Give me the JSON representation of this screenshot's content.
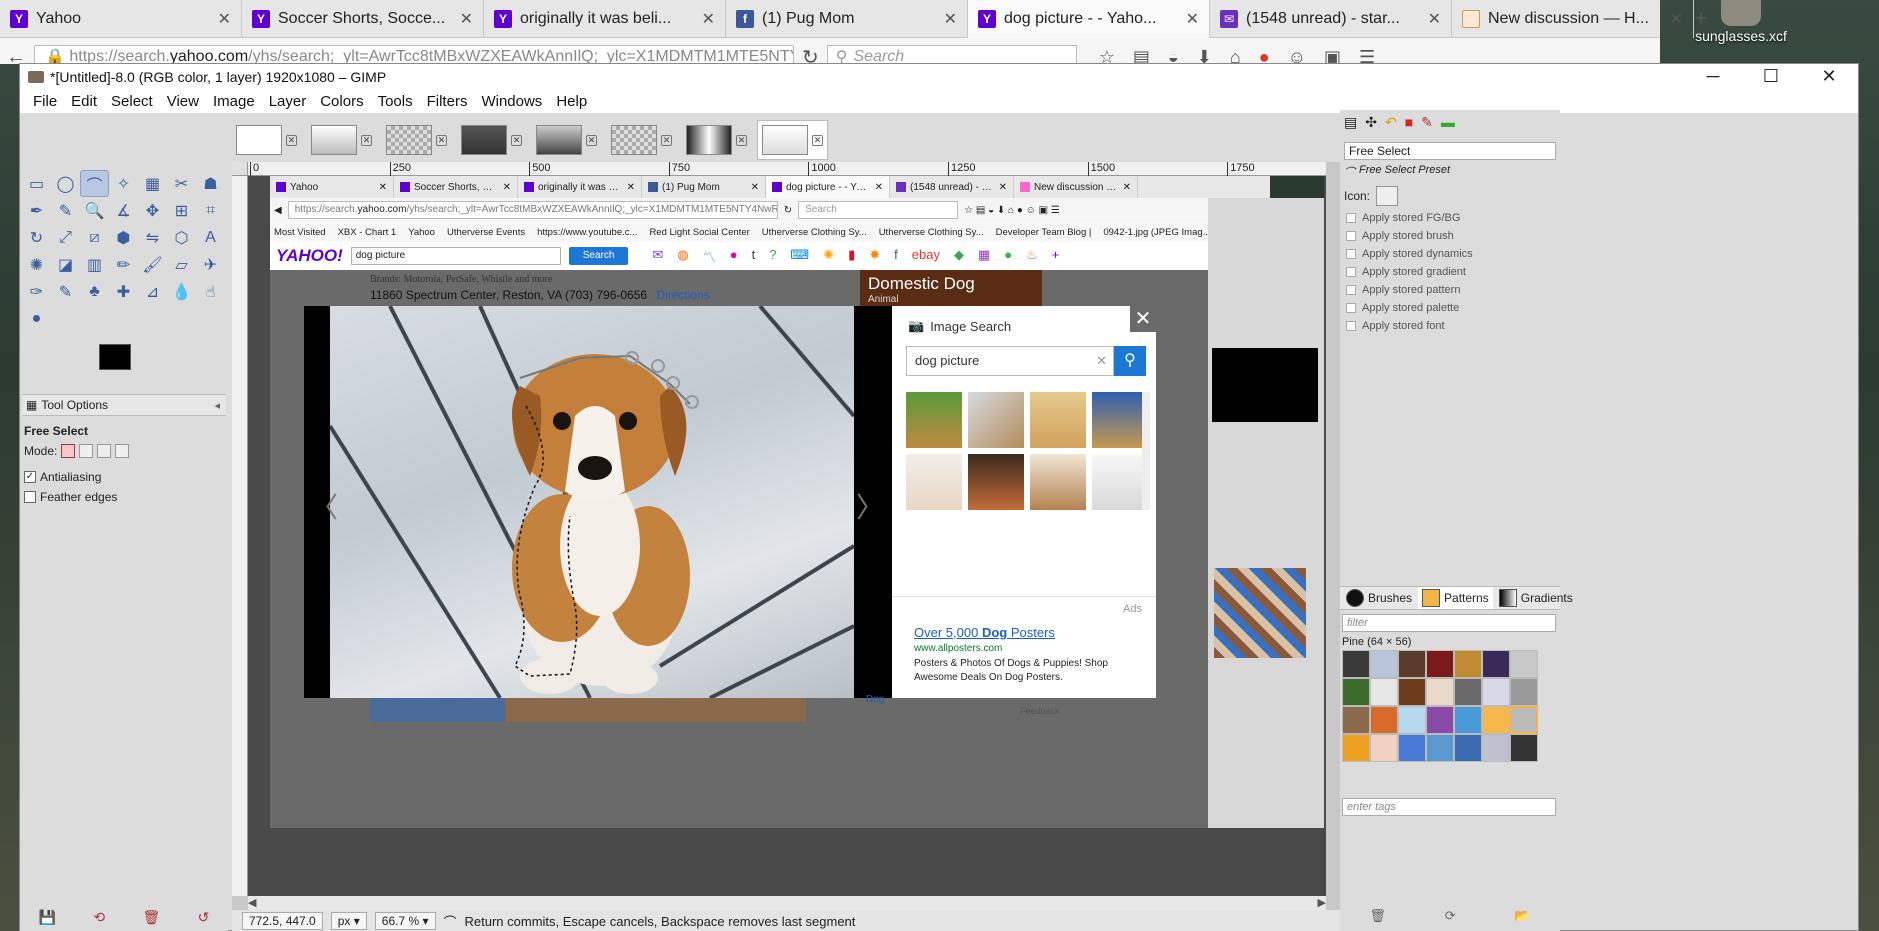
{
  "firefox": {
    "tabs": [
      {
        "title": "Yahoo",
        "icon": "yahoo",
        "active": false
      },
      {
        "title": "Soccer Shorts, Socce...",
        "icon": "yahoo",
        "active": false
      },
      {
        "title": "originally it was beli...",
        "icon": "yahoo",
        "active": false
      },
      {
        "title": "(1) Pug Mom",
        "icon": "facebook",
        "active": false
      },
      {
        "title": "dog picture - - Yaho...",
        "icon": "yahoo",
        "active": true
      },
      {
        "title": "(1548 unread) - star...",
        "icon": "mail",
        "active": false
      },
      {
        "title": "New discussion — H...",
        "icon": "discussion",
        "active": false
      }
    ],
    "url_domain_prefix": "https://search.",
    "url_domain": "yahoo.com",
    "url_rest": "/yhs/search;_ylt=AwrTcc8tMBxWZXEAWkAnnIlQ;_ylc=X1MDMTM1MTE5NTY4NwR",
    "search_placeholder": "Search"
  },
  "desktop": {
    "icon_label": "sunglasses.xcf"
  },
  "gimp": {
    "title": "*[Untitled]-8.0 (RGB color, 1 layer) 1920x1080 – GIMP",
    "menu": [
      "File",
      "Edit",
      "Select",
      "View",
      "Image",
      "Layer",
      "Colors",
      "Tools",
      "Filters",
      "Windows",
      "Help"
    ],
    "ruler_marks": [
      "0",
      "250",
      "500",
      "750",
      "1000",
      "1250",
      "1500",
      "1750"
    ],
    "tool_options": {
      "tab_label": "Tool Options",
      "tool_name": "Free Select",
      "mode_label": "Mode:",
      "antialiasing_label": "Antialiasing",
      "antialiasing_checked": true,
      "feather_label": "Feather edges",
      "feather_checked": false
    },
    "status": {
      "coords": "772.5, 447.0",
      "unit": "px",
      "zoom": "66.7 %",
      "message": "Return commits, Escape cancels, Backspace removes last segment"
    },
    "dock": {
      "preset_name": "Free Select",
      "preset_label": "Free Select Preset",
      "icon_label": "Icon:",
      "options": [
        "Apply stored FG/BG",
        "Apply stored brush",
        "Apply stored dynamics",
        "Apply stored gradient",
        "Apply stored pattern",
        "Apply stored palette",
        "Apply stored font"
      ],
      "tabs": [
        "Brushes",
        "Patterns",
        "Gradients"
      ],
      "filter_placeholder": "filter",
      "pattern_name": "Pine (64 × 56)",
      "tags_placeholder": "enter tags"
    }
  },
  "inner": {
    "tabs": [
      {
        "title": "Yahoo",
        "kind": "y"
      },
      {
        "title": "Soccer Shorts, Socce...",
        "kind": "y"
      },
      {
        "title": "originally it was beli...",
        "kind": "y"
      },
      {
        "title": "(1) Pug Mom",
        "kind": "f"
      },
      {
        "title": "dog picture - - Yaho...",
        "kind": "y"
      },
      {
        "title": "(1548 unread) - star...",
        "kind": "m"
      },
      {
        "title": "New discussion — H...",
        "kind": "h"
      }
    ],
    "url_prefix": "https://search.",
    "url_domain": "yahoo.com",
    "url_rest": "/yhs/search;_ylt=AwrTcc8tMBxWZXEAWkAnnIlQ;_ylc=X1MDMTM1MTE5NTY4NwR",
    "search_placeholder": "Search",
    "bookmarks": [
      "Most Visited",
      "XBX - Chart 1",
      "Yahoo",
      "Utherverse Events",
      "https://www.youtube.c...",
      "Red Light Social Center",
      "Utherverse Clothing Sy...",
      "Utherverse Clothing Sy...",
      "Developer Team Blog |",
      "0942-1.jpg (JPEG Imag..."
    ],
    "yahoo_logo": "YAHOO!",
    "query": "dog picture",
    "search_button": "Search",
    "brands": "Brands: Motorola, PetSafe, Whistle and more",
    "address": "11860 Spectrum Center, Reston, VA   (703) 796-0656",
    "directions": "Directions",
    "domestic_title": "Domestic Dog",
    "domestic_sub": "Animal",
    "image_search_title": "Image Search",
    "image_search_query": "dog picture",
    "ads_label": "Ads",
    "ad_title_pre": "Over 5,000 ",
    "ad_title_bold": "Dog",
    "ad_title_post": " Posters",
    "ad_url": "www.allposters.com",
    "ad_desc": "Posters & Photos Of Dogs & Puppies! Shop Awesome Deals On Dog Posters.",
    "dog_link": "Dog",
    "feedback": "Feedback"
  }
}
